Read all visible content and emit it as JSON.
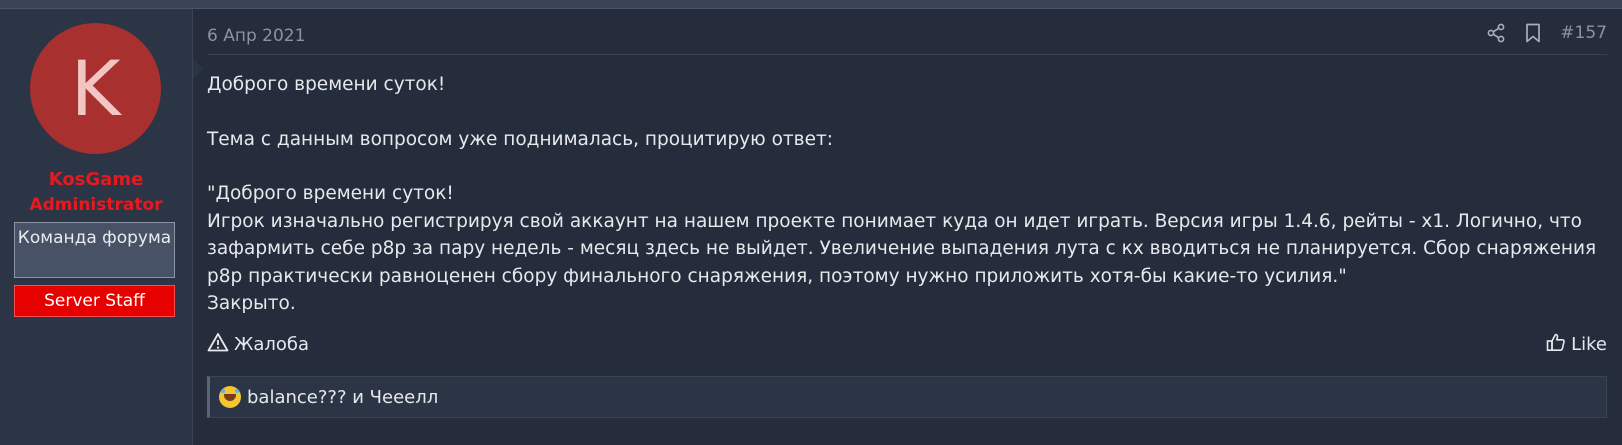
{
  "user": {
    "avatar_letter": "K",
    "name": "KosGame",
    "title": "Administrator",
    "banner_team": "Команда форума",
    "banner_staff": "Server Staff"
  },
  "post": {
    "date": "6 Апр 2021",
    "number": "#157",
    "body": {
      "greeting": "Доброго времени суток!",
      "intro": "Тема с данным вопросом уже поднималась, процитирую ответ:",
      "quote_line1": "\"Доброго времени суток!",
      "quote_line2": "Игрок изначально регистрируя свой аккаунт на нашем проекте понимает куда он идет играть. Версия игры 1.4.6, рейты - х1. Логично, что",
      "quote_line3": "зафармить себе p8p за пару недель - месяц здесь не выйдет. Увеличение выпадения лута с кх вводиться не планируется. Сбор снаряжения",
      "quote_line4": "p8p практически равноценен сбору финального снаряжения, поэтому нужно приложить хотя-бы какие-то усилия.\"",
      "closing": "Закрыто."
    },
    "report_label": "Жалоба",
    "like_label": "Like",
    "reactions_text": "balance??? и Чееелл"
  },
  "icons": {
    "share": "share-icon",
    "bookmark": "bookmark-icon",
    "report": "warning-triangle-icon",
    "like": "thumbs-up-icon",
    "reaction": "rolling-laughing-emoji"
  },
  "colors": {
    "username": "#e8191e",
    "avatar_bg": "#a8302f",
    "staff_banner": "#e60000"
  }
}
